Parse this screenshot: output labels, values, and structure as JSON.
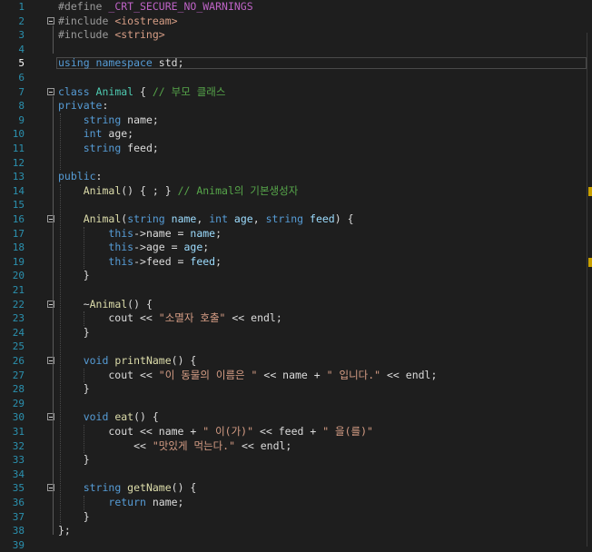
{
  "editor": {
    "current_line": 5,
    "lines": [
      {
        "n": "1",
        "t": [
          [
            "pp",
            "#define "
          ],
          [
            "mac",
            "_CRT_SECURE_NO_WARNINGS"
          ]
        ]
      },
      {
        "n": "2",
        "fold": true,
        "t": [
          [
            "pp",
            "#include "
          ],
          [
            "str",
            "<iostream>"
          ]
        ]
      },
      {
        "n": "3",
        "t": [
          [
            "pp",
            "#include "
          ],
          [
            "str",
            "<string>"
          ]
        ]
      },
      {
        "n": "4",
        "t": []
      },
      {
        "n": "5",
        "t": [
          [
            "kw",
            "using "
          ],
          [
            "kw",
            "namespace "
          ],
          [
            "",
            "std;"
          ]
        ]
      },
      {
        "n": "6",
        "t": []
      },
      {
        "n": "7",
        "fold": true,
        "t": [
          [
            "kw",
            "class "
          ],
          [
            "ty",
            "Animal"
          ],
          [
            "",
            " { "
          ],
          [
            "cm",
            "// 부모 클래스"
          ]
        ]
      },
      {
        "n": "8",
        "t": [
          [
            "kw",
            "private"
          ],
          [
            "",
            ":"
          ]
        ]
      },
      {
        "n": "9",
        "t": [
          [
            "",
            "    "
          ],
          [
            "kw",
            "string "
          ],
          [
            "",
            "name;"
          ]
        ]
      },
      {
        "n": "10",
        "t": [
          [
            "",
            "    "
          ],
          [
            "kw",
            "int "
          ],
          [
            "",
            "age;"
          ]
        ]
      },
      {
        "n": "11",
        "t": [
          [
            "",
            "    "
          ],
          [
            "kw",
            "string "
          ],
          [
            "",
            "feed;"
          ]
        ]
      },
      {
        "n": "12",
        "t": []
      },
      {
        "n": "13",
        "t": [
          [
            "kw",
            "public"
          ],
          [
            "",
            ":"
          ]
        ]
      },
      {
        "n": "14",
        "t": [
          [
            "",
            "    "
          ],
          [
            "fn",
            "Animal"
          ],
          [
            "",
            "() { ; } "
          ],
          [
            "cm",
            "// Animal의 기본생성자"
          ]
        ]
      },
      {
        "n": "15",
        "t": []
      },
      {
        "n": "16",
        "fold": true,
        "t": [
          [
            "",
            "    "
          ],
          [
            "fn",
            "Animal"
          ],
          [
            "",
            "("
          ],
          [
            "kw",
            "string "
          ],
          [
            "pa",
            "name"
          ],
          [
            "",
            ", "
          ],
          [
            "kw",
            "int "
          ],
          [
            "pa",
            "age"
          ],
          [
            "",
            ", "
          ],
          [
            "kw",
            "string "
          ],
          [
            "pa",
            "feed"
          ],
          [
            "",
            ") {"
          ]
        ]
      },
      {
        "n": "17",
        "t": [
          [
            "",
            "        "
          ],
          [
            "kw",
            "this"
          ],
          [
            "",
            "->name = "
          ],
          [
            "pa",
            "name"
          ],
          [
            "",
            ";"
          ]
        ]
      },
      {
        "n": "18",
        "t": [
          [
            "",
            "        "
          ],
          [
            "kw",
            "this"
          ],
          [
            "",
            "->age = "
          ],
          [
            "pa",
            "age"
          ],
          [
            "",
            ";"
          ]
        ]
      },
      {
        "n": "19",
        "t": [
          [
            "",
            "        "
          ],
          [
            "kw",
            "this"
          ],
          [
            "",
            "->feed = "
          ],
          [
            "pa",
            "feed"
          ],
          [
            "",
            ";"
          ]
        ]
      },
      {
        "n": "20",
        "t": [
          [
            "",
            "    }"
          ]
        ]
      },
      {
        "n": "21",
        "t": []
      },
      {
        "n": "22",
        "fold": true,
        "t": [
          [
            "",
            "    ~"
          ],
          [
            "fn",
            "Animal"
          ],
          [
            "",
            "() {"
          ]
        ]
      },
      {
        "n": "23",
        "t": [
          [
            "",
            "        cout << "
          ],
          [
            "str",
            "\"소멸자 호출\""
          ],
          [
            "",
            " << endl;"
          ]
        ]
      },
      {
        "n": "24",
        "t": [
          [
            "",
            "    }"
          ]
        ]
      },
      {
        "n": "25",
        "t": []
      },
      {
        "n": "26",
        "fold": true,
        "t": [
          [
            "",
            "    "
          ],
          [
            "kw",
            "void "
          ],
          [
            "fn",
            "printName"
          ],
          [
            "",
            "() {"
          ]
        ]
      },
      {
        "n": "27",
        "t": [
          [
            "",
            "        cout << "
          ],
          [
            "str",
            "\"이 동물의 이름은 \""
          ],
          [
            "",
            " << name + "
          ],
          [
            "str",
            "\" 입니다.\""
          ],
          [
            "",
            " << endl;"
          ]
        ]
      },
      {
        "n": "28",
        "t": [
          [
            "",
            "    }"
          ]
        ]
      },
      {
        "n": "29",
        "t": []
      },
      {
        "n": "30",
        "fold": true,
        "t": [
          [
            "",
            "    "
          ],
          [
            "kw",
            "void "
          ],
          [
            "fn",
            "eat"
          ],
          [
            "",
            "() {"
          ]
        ]
      },
      {
        "n": "31",
        "t": [
          [
            "",
            "        cout << name + "
          ],
          [
            "str",
            "\" 이(가)\""
          ],
          [
            "",
            " << feed + "
          ],
          [
            "str",
            "\" 을(를)\""
          ]
        ]
      },
      {
        "n": "32",
        "t": [
          [
            "",
            "            << "
          ],
          [
            "str",
            "\"맛있게 먹는다.\""
          ],
          [
            "",
            " << endl;"
          ]
        ]
      },
      {
        "n": "33",
        "t": [
          [
            "",
            "    }"
          ]
        ]
      },
      {
        "n": "34",
        "t": []
      },
      {
        "n": "35",
        "fold": true,
        "t": [
          [
            "",
            "    "
          ],
          [
            "kw",
            "string "
          ],
          [
            "fn",
            "getName"
          ],
          [
            "",
            "() {"
          ]
        ]
      },
      {
        "n": "36",
        "t": [
          [
            "",
            "        "
          ],
          [
            "kw",
            "return "
          ],
          [
            "",
            "name;"
          ]
        ]
      },
      {
        "n": "37",
        "t": [
          [
            "",
            "    }"
          ]
        ]
      },
      {
        "n": "38",
        "t": [
          [
            "",
            "};"
          ]
        ]
      },
      {
        "n": "39",
        "t": []
      }
    ]
  }
}
